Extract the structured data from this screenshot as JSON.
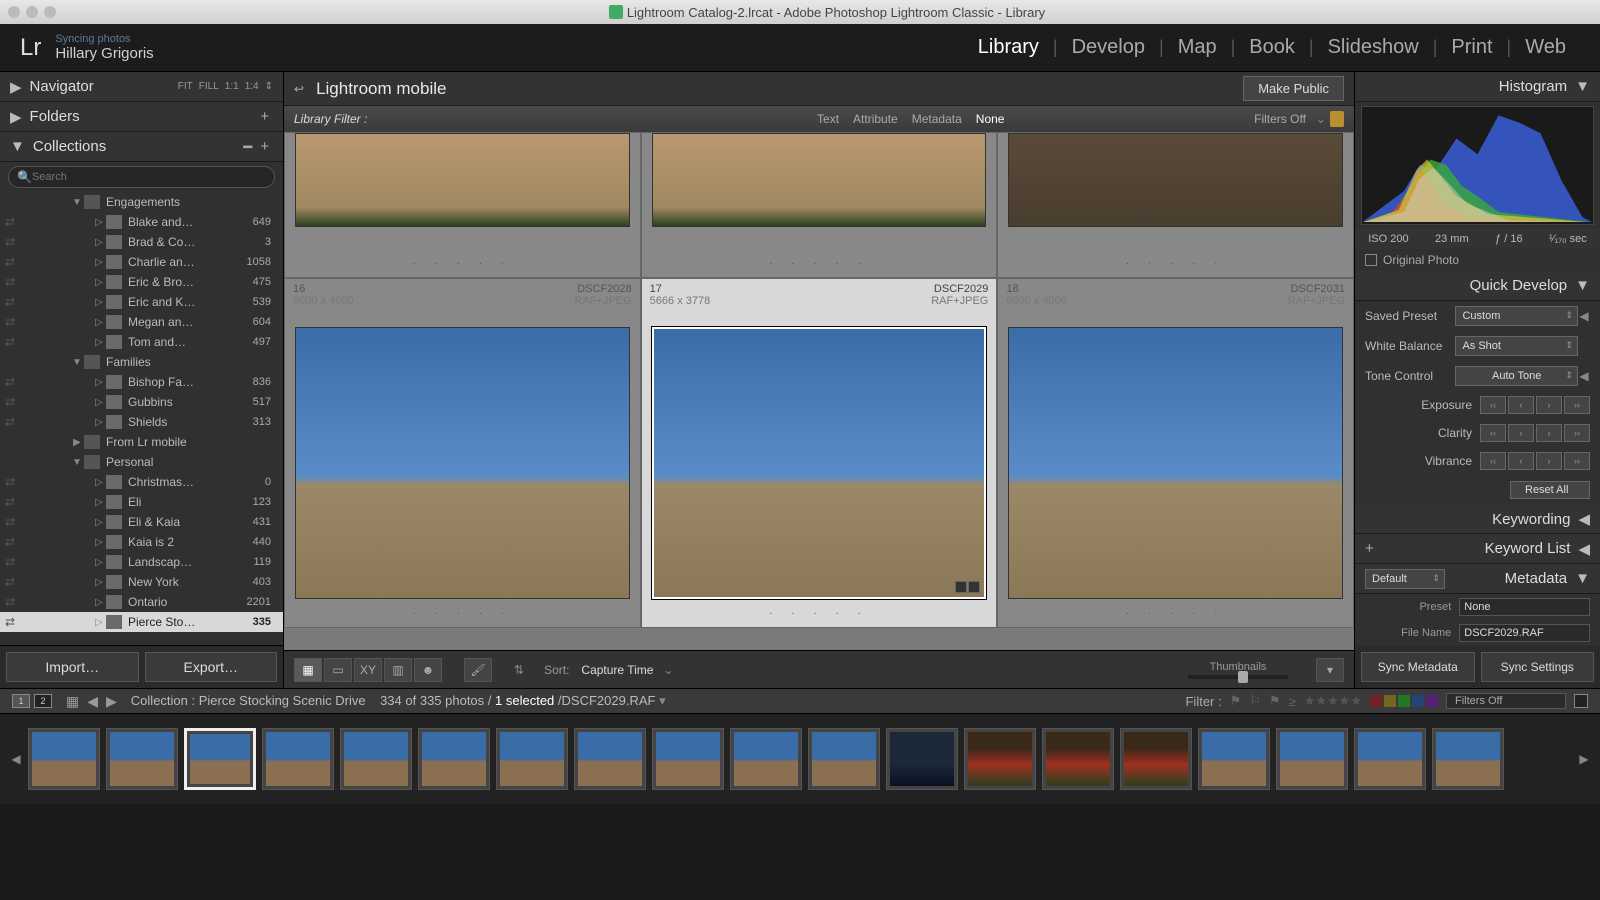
{
  "titlebar": {
    "title": "Lightroom Catalog-2.lrcat - Adobe Photoshop Lightroom Classic - Library"
  },
  "identity": {
    "syncing": "Syncing photos",
    "user": "Hillary Grigoris",
    "logo": "Lr"
  },
  "modules": [
    "Library",
    "Develop",
    "Map",
    "Book",
    "Slideshow",
    "Print",
    "Web"
  ],
  "active_module": "Library",
  "left": {
    "navigator": {
      "title": "Navigator",
      "opts": [
        "FIT",
        "FILL",
        "1:1",
        "1:4"
      ]
    },
    "folders": "Folders",
    "collections": "Collections",
    "search_placeholder": "Search",
    "tree": [
      {
        "type": "set",
        "depth": 1,
        "name": "Engagements",
        "expanded": true
      },
      {
        "type": "coll",
        "depth": 2,
        "name": "Blake and…",
        "count": 649
      },
      {
        "type": "coll",
        "depth": 2,
        "name": "Brad & Co…",
        "count": 3
      },
      {
        "type": "coll",
        "depth": 2,
        "name": "Charlie an…",
        "count": 1058
      },
      {
        "type": "coll",
        "depth": 2,
        "name": "Eric & Bro…",
        "count": 475
      },
      {
        "type": "coll",
        "depth": 2,
        "name": "Eric and K…",
        "count": 539
      },
      {
        "type": "coll",
        "depth": 2,
        "name": "Megan an…",
        "count": 604
      },
      {
        "type": "coll",
        "depth": 2,
        "name": "Tom and…",
        "count": 497
      },
      {
        "type": "set",
        "depth": 1,
        "name": "Families",
        "expanded": true
      },
      {
        "type": "coll",
        "depth": 2,
        "name": "Bishop Fa…",
        "count": 836
      },
      {
        "type": "coll",
        "depth": 2,
        "name": "Gubbins",
        "count": 517
      },
      {
        "type": "coll",
        "depth": 2,
        "name": "Shields",
        "count": 313
      },
      {
        "type": "set",
        "depth": 1,
        "name": "From Lr mobile",
        "expanded": false
      },
      {
        "type": "set",
        "depth": 1,
        "name": "Personal",
        "expanded": true
      },
      {
        "type": "coll",
        "depth": 2,
        "name": "Christmas…",
        "count": 0
      },
      {
        "type": "coll",
        "depth": 2,
        "name": "Eli",
        "count": 123
      },
      {
        "type": "coll",
        "depth": 2,
        "name": "Eli & Kaia",
        "count": 431
      },
      {
        "type": "coll",
        "depth": 2,
        "name": "Kaia is 2",
        "count": 440
      },
      {
        "type": "coll",
        "depth": 2,
        "name": "Landscap…",
        "count": 119
      },
      {
        "type": "coll",
        "depth": 2,
        "name": "New York",
        "count": 403
      },
      {
        "type": "coll",
        "depth": 2,
        "name": "Ontario",
        "count": 2201
      },
      {
        "type": "coll",
        "depth": 2,
        "name": "Pierce Sto…",
        "count": 335,
        "selected": true
      }
    ],
    "import": "Import…",
    "export": "Export…"
  },
  "center": {
    "breadcrumb": "Lightroom mobile",
    "make_public": "Make Public",
    "filter_label": "Library Filter :",
    "filter_tabs": [
      "Text",
      "Attribute",
      "Metadata",
      "None"
    ],
    "filter_active": "None",
    "filters_off": "Filters Off",
    "cells_top": [
      {
        "file": "",
        "dim": ""
      },
      {
        "file": "",
        "dim": ""
      },
      {
        "file": "",
        "dim": "",
        "dark": true
      }
    ],
    "cells": [
      {
        "idx": "16",
        "file": "DSCF2028",
        "dim": "6000 x 4000",
        "type": "RAF+JPEG"
      },
      {
        "idx": "17",
        "file": "DSCF2029",
        "dim": "5666 x 3778",
        "type": "RAF+JPEG",
        "selected": true
      },
      {
        "idx": "18",
        "file": "DSCF2031",
        "dim": "6000 x 4000",
        "type": "RAF+JPEG"
      }
    ],
    "sort_label": "Sort:",
    "sort_value": "Capture Time",
    "thumbnails": "Thumbnails"
  },
  "right": {
    "histogram": "Histogram",
    "histo_info": {
      "iso": "ISO 200",
      "focal": "23 mm",
      "aperture": "ƒ / 16",
      "shutter": "¹⁄₁₇₀ sec"
    },
    "original": "Original Photo",
    "quick_develop": "Quick Develop",
    "saved_preset": {
      "label": "Saved Preset",
      "value": "Custom"
    },
    "white_balance": {
      "label": "White Balance",
      "value": "As Shot"
    },
    "tone": {
      "label": "Tone Control",
      "btn": "Auto Tone"
    },
    "sliders": [
      "Exposure",
      "Clarity",
      "Vibrance"
    ],
    "reset": "Reset All",
    "keywording": "Keywording",
    "keyword_list": "Keyword List",
    "metadata": "Metadata",
    "default": "Default",
    "preset": {
      "label": "Preset",
      "value": "None"
    },
    "file_name": {
      "label": "File Name",
      "value": "DSCF2029.RAF"
    },
    "sync_meta": "Sync Metadata",
    "sync_set": "Sync Settings"
  },
  "filmstrip": {
    "collection_label": "Collection : Pierce Stocking Scenic Drive",
    "counts": "334 of 335 photos /",
    "selected": "1 selected",
    "file": "/DSCF2029.RAF",
    "filter": "Filter :",
    "filters_off": "Filters Off"
  }
}
